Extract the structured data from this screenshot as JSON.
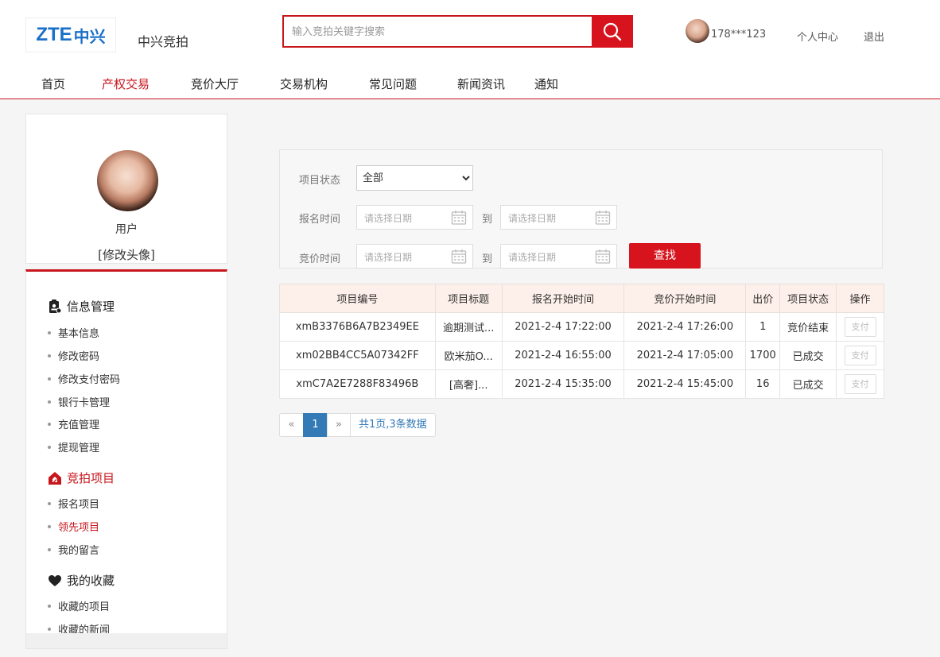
{
  "header": {
    "logo_zte": "ZTE",
    "logo_cn": "中兴",
    "site_name": "中兴竞拍",
    "search_placeholder": "输入竞拍关键字搜索",
    "user_name": "178***123",
    "link_personal": "个人中心",
    "link_logout": "退出"
  },
  "nav": {
    "items": [
      "首页",
      "产权交易",
      "竞价大厅",
      "交易机构",
      "常见问题",
      "新闻资讯",
      "通知"
    ],
    "active": "产权交易"
  },
  "profile": {
    "name": "用户",
    "edit_avatar": "[修改头像]"
  },
  "menu": {
    "groups": [
      {
        "title": "信息管理",
        "icon": "id-badge-icon",
        "items": [
          "基本信息",
          "修改密码",
          "修改支付密码",
          "银行卡管理",
          "充值管理",
          "提现管理"
        ]
      },
      {
        "title": "竞拍项目",
        "icon": "house-icon",
        "items": [
          "报名项目",
          "领先项目",
          "我的留言"
        ]
      },
      {
        "title": "我的收藏",
        "icon": "heart-icon",
        "items": [
          "收藏的项目",
          "收藏的新闻"
        ]
      }
    ],
    "active_item": "领先项目"
  },
  "filter": {
    "status_label": "项目状态",
    "status_value": "全部",
    "signup_label": "报名时间",
    "bid_label": "竞价时间",
    "date_placeholder": "请选择日期",
    "to_label": "到",
    "search_button": "查找"
  },
  "table": {
    "headers": [
      "项目编号",
      "项目标题",
      "报名开始时间",
      "竞价开始时间",
      "出价",
      "项目状态",
      "操作"
    ],
    "rows": [
      [
        "xmB3376B6A7B2349EE",
        "逾期测试...",
        "2021-2-4 17:22:00",
        "2021-2-4 17:26:00",
        "1",
        "竞价结束",
        "支付"
      ],
      [
        "xm02BB4CC5A07342FF",
        "欧米茄O...",
        "2021-2-4 16:55:00",
        "2021-2-4 17:05:00",
        "1700",
        "已成交",
        "支付"
      ],
      [
        "xmC7A2E7288F83496B",
        "[高奢]...",
        "2021-2-4 15:35:00",
        "2021-2-4 15:45:00",
        "16",
        "已成交",
        "支付"
      ]
    ]
  },
  "pager": {
    "prev": "«",
    "current": "1",
    "next": "»",
    "info": "共1页,3条数据"
  },
  "colors": {
    "accent": "#c8161d",
    "brand_blue": "#1a6fc9",
    "pager_blue": "#337ab7"
  }
}
